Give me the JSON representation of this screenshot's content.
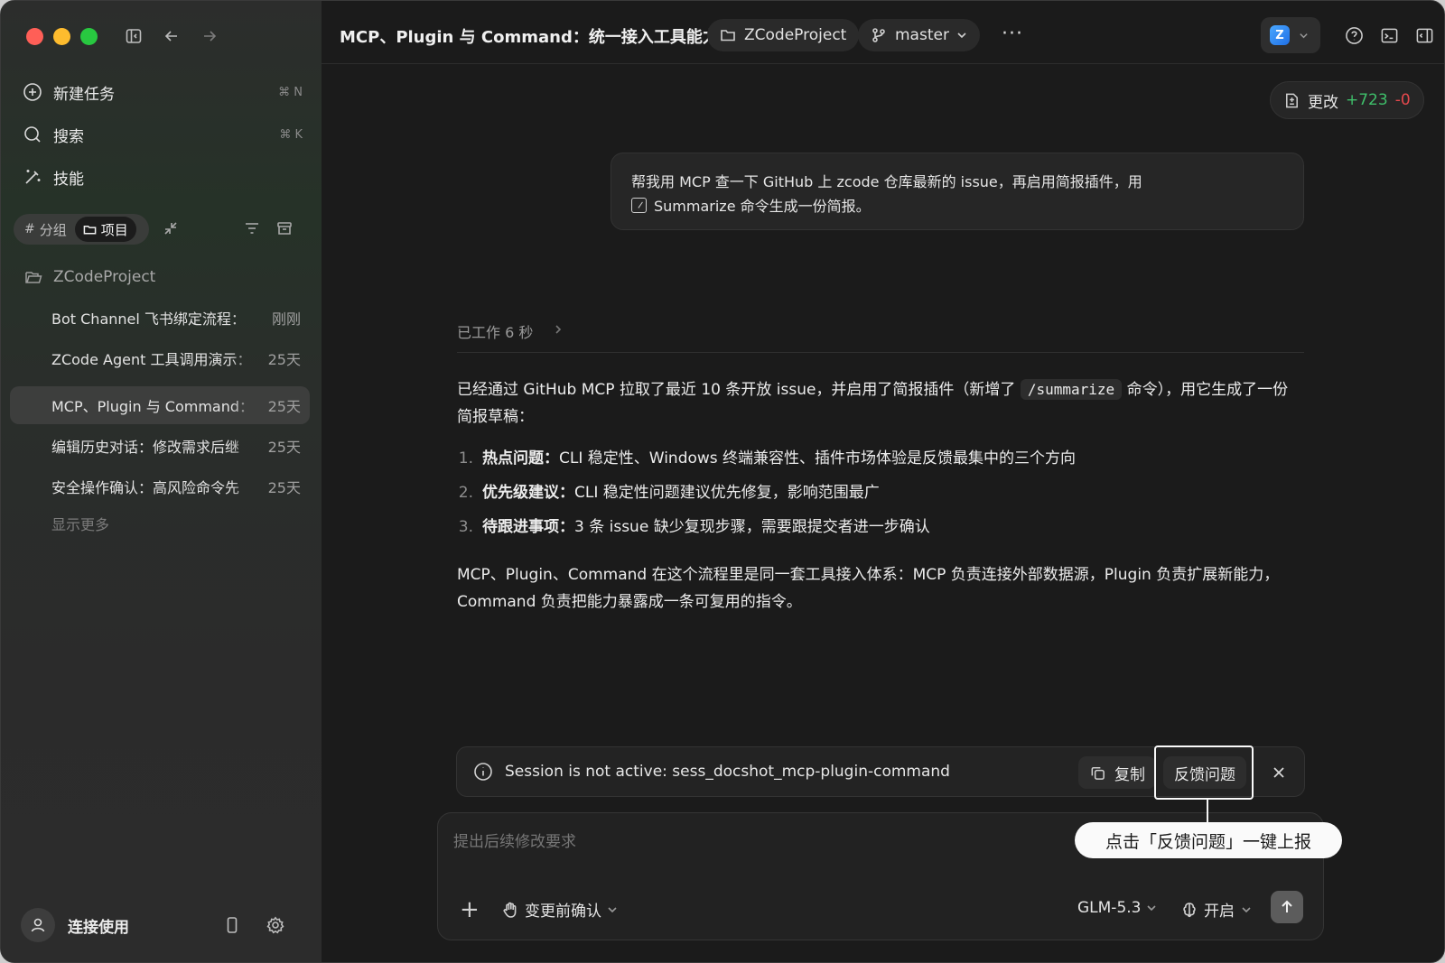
{
  "sidebar": {
    "nav": [
      {
        "label": "新建任务",
        "shortcut": "⌘ N"
      },
      {
        "label": "搜索",
        "shortcut": "⌘ K"
      },
      {
        "label": "技能",
        "shortcut": ""
      }
    ],
    "segments": {
      "group": "分组",
      "project": "项目",
      "group_glyph": "#"
    },
    "project_name": "ZCodeProject",
    "tasks": [
      {
        "title": "Bot Channel 飞书绑定流程：",
        "time": "刚刚",
        "active": false
      },
      {
        "title": "ZCode Agent 工具调用演示：",
        "time": "25天",
        "active": false
      },
      {
        "title": "MCP、Plugin 与 Command：",
        "time": "25天",
        "active": true
      },
      {
        "title": "编辑历史对话：修改需求后继",
        "time": "25天",
        "active": false
      },
      {
        "title": "安全操作确认：高风险命令先",
        "time": "25天",
        "active": false
      }
    ],
    "show_more": "显示更多",
    "account_label": "连接使用"
  },
  "topbar": {
    "title": "MCP、Plugin 与 Command：统一接入工具能力",
    "project_pill": "ZCodeProject",
    "branch_pill": "master",
    "more": "···",
    "app_logo_letter": "Z"
  },
  "changes": {
    "label": "更改",
    "added": "+723",
    "removed": "-0"
  },
  "user_message": {
    "line1": "帮我用 MCP 查一下 GitHub 上 zcode 仓库最新的 issue，再启用简报插件，用",
    "command": "Summarize",
    "line2_tail": "命令生成一份简报。"
  },
  "assistant": {
    "worked": "已工作 6 秒",
    "para1_before": "已经通过 GitHub MCP 拉取了最近 10 条开放 issue，并启用了简报插件（新增了",
    "para1_code": "/summarize",
    "para1_after": "命令），用它生成了一份简报草稿：",
    "items": [
      {
        "num": "1.",
        "bold": "热点问题：",
        "text": "CLI 稳定性、Windows 终端兼容性、插件市场体验是反馈最集中的三个方向"
      },
      {
        "num": "2.",
        "bold": "优先级建议：",
        "text": "CLI 稳定性问题建议优先修复，影响范围最广"
      },
      {
        "num": "3.",
        "bold": "待跟进事项：",
        "text": "3 条 issue 缺少复现步骤，需要跟提交者进一步确认"
      }
    ],
    "para2": "MCP、Plugin、Command 在这个流程里是同一套工具接入体系：MCP 负责连接外部数据源，Plugin 负责扩展新能力，Command 负责把能力暴露成一条可复用的指令。"
  },
  "banner": {
    "message": "Session is not active: sess_docshot_mcp-plugin-command",
    "copy_label": "复制",
    "feedback_label": "反馈问题"
  },
  "callout": "点击「反馈问题」一键上报",
  "composer": {
    "placeholder": "提出后续修改要求",
    "plus": "+",
    "mode": "变更前确认",
    "model": "GLM-5.3",
    "thinking": "开启"
  },
  "colors": {
    "added": "#3fbf6a",
    "removed": "#e5484d",
    "accent_logo": "#1f6fe6"
  }
}
